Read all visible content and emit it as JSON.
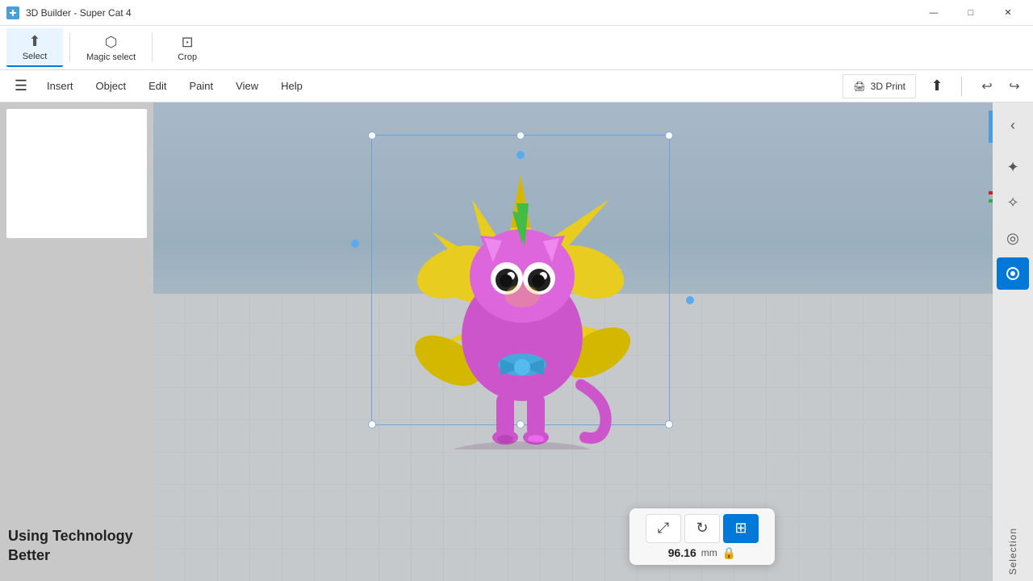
{
  "titleBar": {
    "title": "3D Builder - Super Cat 4",
    "minimizeLabel": "—",
    "maximizeLabel": "□",
    "closeLabel": "✕"
  },
  "toolbar": {
    "selectLabel": "Select",
    "magicSelectLabel": "Magic select",
    "cropLabel": "Crop"
  },
  "menuBar": {
    "items": [
      "Insert",
      "Object",
      "Edit",
      "Paint",
      "View",
      "Help"
    ],
    "printLabel": "3D Print",
    "undoLabel": "↩",
    "redoLabel": "↪"
  },
  "rightSidebar": {
    "backLabel": "‹",
    "tools": [
      "✦",
      "✧",
      "◎",
      "⊙"
    ],
    "selectionLabel": "Selection"
  },
  "bottomToolbar": {
    "moveLabel": "⤢",
    "rotateLabel": "↻",
    "scaleLabel": "⊞",
    "measureValue": "96.16",
    "measureUnit": "mm",
    "lockLabel": "🔒"
  },
  "leftBottomText": "Using Technology Better",
  "viewport": {
    "bgColor": "#a8b8c8"
  }
}
